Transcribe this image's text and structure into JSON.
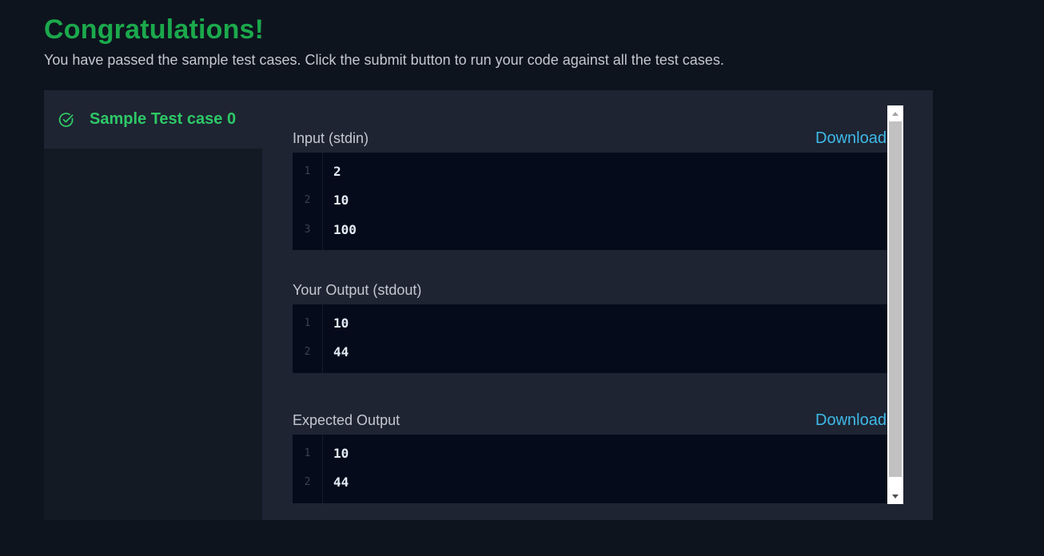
{
  "header": {
    "title": "Congratulations!",
    "subtitle": "You have passed the sample test cases. Click the submit button to run your code against all the test cases."
  },
  "sidebar": {
    "tabs": [
      {
        "label": "Sample Test case 0",
        "icon": "check-circle-icon",
        "status": "passed"
      }
    ]
  },
  "sections": {
    "input": {
      "label": "Input (stdin)",
      "download_label": "Download",
      "lines": [
        {
          "num": "1",
          "text": "2"
        },
        {
          "num": "2",
          "text": "10"
        },
        {
          "num": "3",
          "text": "100"
        }
      ]
    },
    "output": {
      "label": "Your Output (stdout)",
      "lines": [
        {
          "num": "1",
          "text": "10"
        },
        {
          "num": "2",
          "text": "44"
        }
      ]
    },
    "expected": {
      "label": "Expected Output",
      "download_label": "Download",
      "lines": [
        {
          "num": "1",
          "text": "10"
        },
        {
          "num": "2",
          "text": "44"
        }
      ]
    }
  },
  "colors": {
    "success": "#1ba94c",
    "link": "#3fb9e8",
    "background": "#0e141e",
    "panel": "#1e2432",
    "code_background": "#050b1a"
  }
}
